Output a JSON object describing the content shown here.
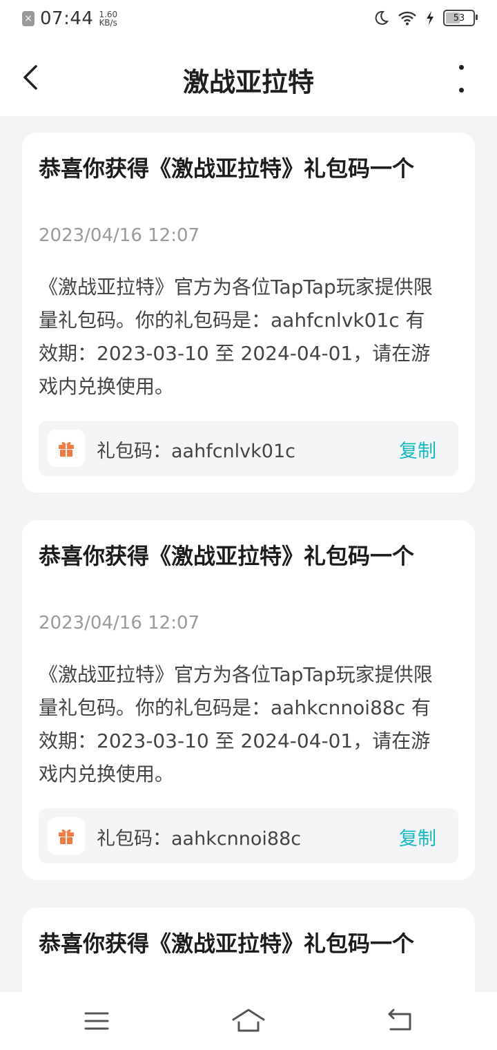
{
  "status_bar": {
    "time": "07:44",
    "net_speed_value": "1.60",
    "net_speed_unit": "KB/s",
    "battery": "53",
    "icons": [
      "notification-icon",
      "moon-icon",
      "wifi-icon",
      "charging-icon",
      "battery-icon"
    ]
  },
  "header": {
    "title": "激战亚拉特"
  },
  "cards": [
    {
      "title": "恭喜你获得《激战亚拉特》礼包码一个",
      "date": "2023/04/16 12:07",
      "body": "《激战亚拉特》官方为各位TapTap玩家提供限量礼包码。你的礼包码是：aahfcnlvk01c 有效期：2023-03-10 至 2024-04-01，请在游戏内兑换使用。",
      "code_label": "礼包码：aahfcnlvk01c",
      "copy_label": "复制"
    },
    {
      "title": "恭喜你获得《激战亚拉特》礼包码一个",
      "date": "2023/04/16 12:07",
      "body": "《激战亚拉特》官方为各位TapTap玩家提供限量礼包码。你的礼包码是：aahkcnnoi88c 有效期：2023-03-10 至 2024-04-01，请在游戏内兑换使用。",
      "code_label": "礼包码：aahkcnnoi88c",
      "copy_label": "复制"
    },
    {
      "title": "恭喜你获得《激战亚拉特》礼包码一个"
    }
  ],
  "colors": {
    "accent": "#16b8c6",
    "gift": "#f47a45",
    "background": "#f3f4f6"
  },
  "nav_bar": {
    "icons": [
      "menu-icon",
      "home-icon",
      "back-icon"
    ]
  }
}
